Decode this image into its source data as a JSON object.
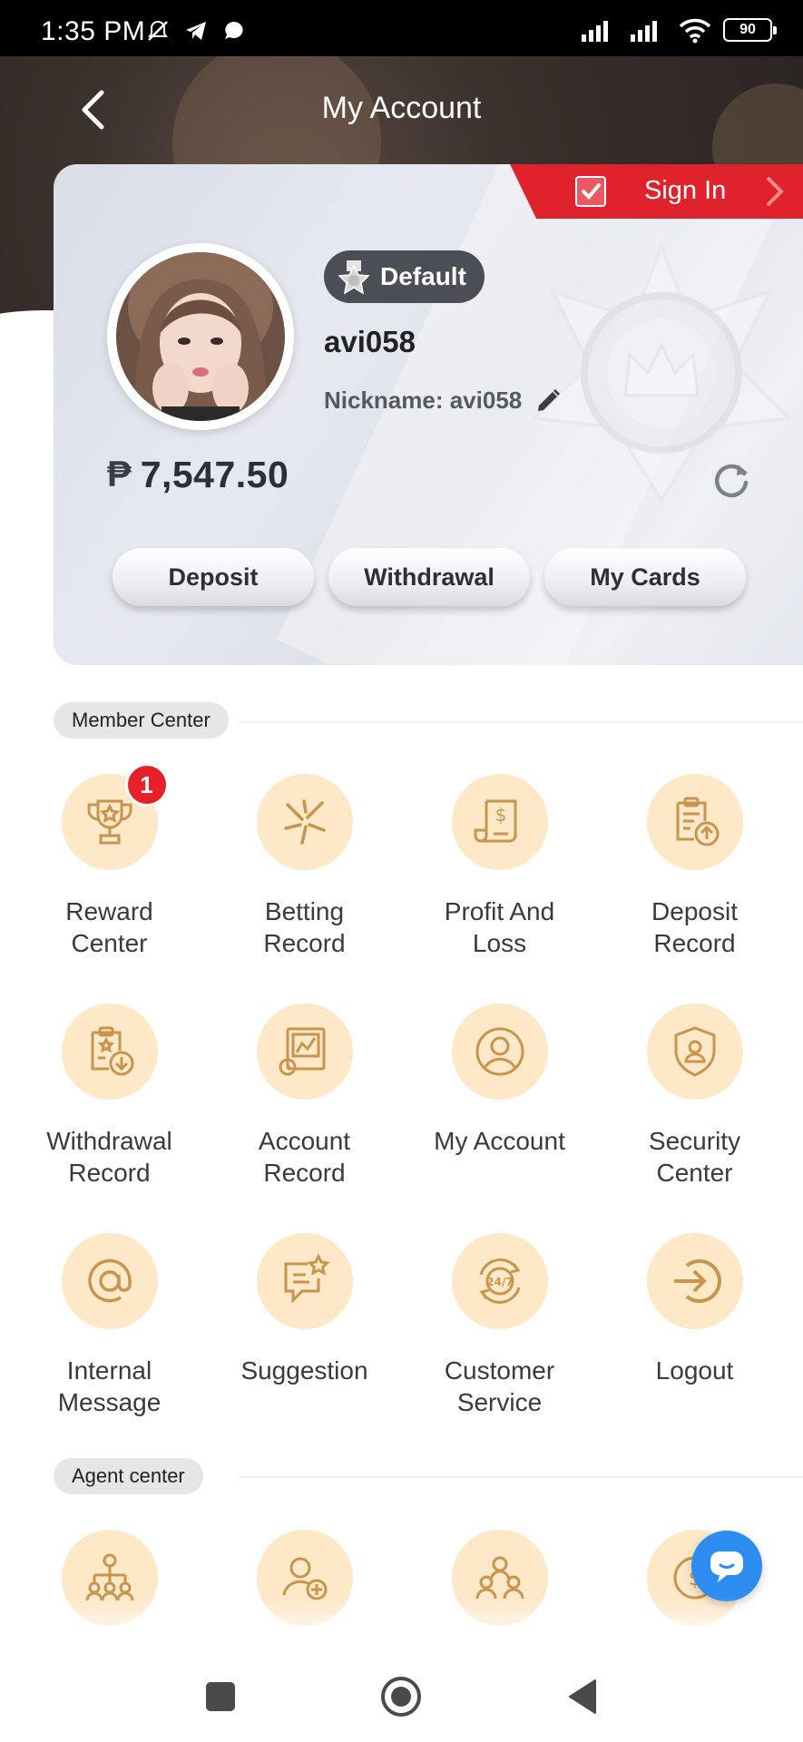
{
  "status_bar": {
    "time": "1:35 PM",
    "battery": "90",
    "icons": [
      "mute-icon",
      "telegram-icon",
      "chat-bubble-icon",
      "signal-icon",
      "signal-icon",
      "wifi-icon",
      "battery-icon"
    ]
  },
  "header": {
    "title": "My Account",
    "back_icon": "chevron-left-icon"
  },
  "profile": {
    "sign_in_label": "Sign In",
    "vip_level": "Default",
    "username": "avi058",
    "nickname": "Nickname: avi058",
    "currency_symbol": "₱",
    "balance": "7,547.50"
  },
  "actions": {
    "deposit": "Deposit",
    "withdrawal": "Withdrawal",
    "my_cards": "My Cards"
  },
  "member_center": {
    "title": "Member Center",
    "items": [
      {
        "label": "Reward\nCenter",
        "icon": "trophy-icon",
        "badge": "1"
      },
      {
        "label": "Betting\nRecord",
        "icon": "sparkle-icon"
      },
      {
        "label": "Profit And\nLoss",
        "icon": "receipt-dollar-icon"
      },
      {
        "label": "Deposit\nRecord",
        "icon": "clipboard-upload-icon"
      },
      {
        "label": "Withdrawal\nRecord",
        "icon": "clipboard-download-icon"
      },
      {
        "label": "Account\nRecord",
        "icon": "chart-report-icon"
      },
      {
        "label": "My Account",
        "icon": "user-circle-icon"
      },
      {
        "label": "Security\nCenter",
        "icon": "shield-user-icon"
      },
      {
        "label": "Internal\nMessage",
        "icon": "at-sign-icon"
      },
      {
        "label": "Suggestion",
        "icon": "message-star-icon"
      },
      {
        "label": "Customer\nService",
        "icon": "support-24-7-icon"
      },
      {
        "label": "Logout",
        "icon": "logout-icon"
      }
    ]
  },
  "agent_center": {
    "title": "Agent center",
    "items": [
      {
        "icon": "org-chart-icon"
      },
      {
        "icon": "add-user-icon"
      },
      {
        "icon": "team-icon"
      },
      {
        "icon": "commission-icon"
      }
    ]
  },
  "colors": {
    "accent_red": "#e0222d",
    "icon_bg": "#fde8c8",
    "icon_stroke": "#c9954e",
    "chat_fab": "#2d8cf0"
  }
}
